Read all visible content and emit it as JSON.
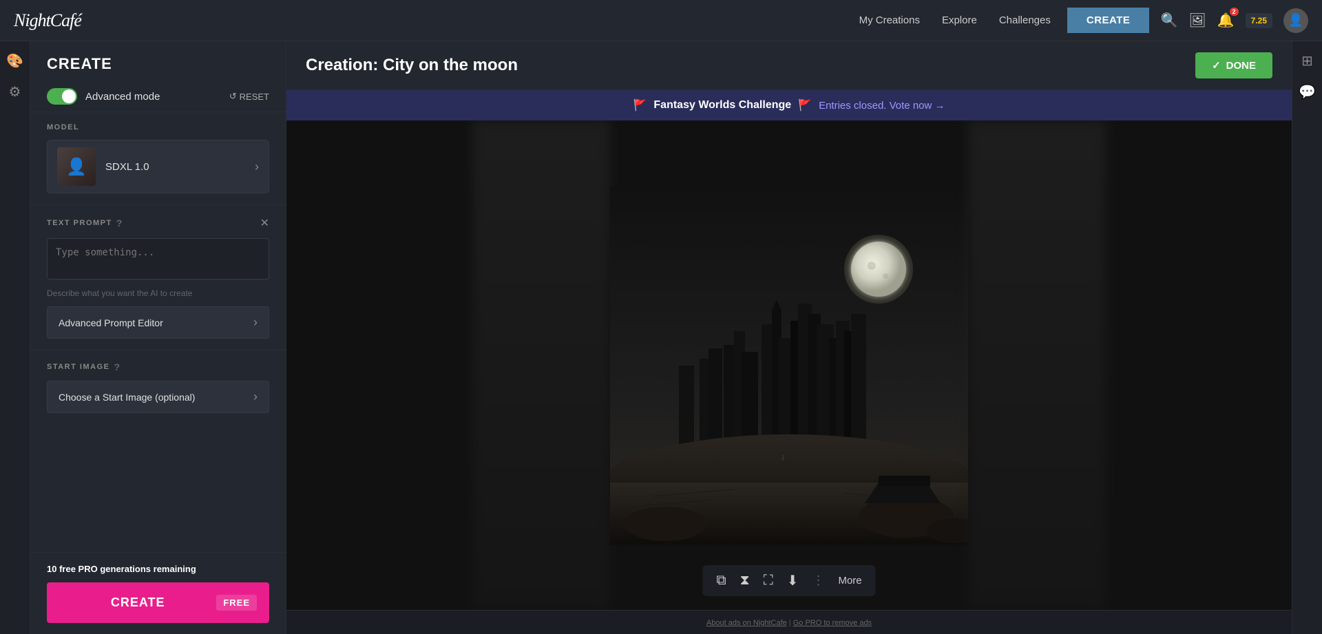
{
  "app": {
    "logo": "NightCafé"
  },
  "nav": {
    "links": [
      {
        "label": "My Creations",
        "key": "my-creations"
      },
      {
        "label": "Explore",
        "key": "explore"
      },
      {
        "label": "Challenges",
        "key": "challenges"
      }
    ],
    "create_label": "CREATE",
    "credits": "7.25",
    "notification_count": "2"
  },
  "sidebar": {
    "title": "CREATE",
    "advanced_mode": {
      "label": "Advanced mode",
      "enabled": true
    },
    "reset_label": "RESET",
    "model_section_label": "MODEL",
    "model": {
      "name": "SDXL 1.0"
    },
    "text_prompt": {
      "section_label": "TEXT PROMPT",
      "placeholder": "Type something...",
      "hint": "Describe what you want the AI to create",
      "advanced_editor_label": "Advanced Prompt Editor"
    },
    "start_image": {
      "section_label": "START IMAGE",
      "button_label": "Choose a Start Image (optional)"
    },
    "free_generations": {
      "count": "10",
      "text": "free PRO generations remaining"
    },
    "create_button": "CREATE",
    "free_tag": "FREE"
  },
  "creation": {
    "title": "Creation: City on the moon",
    "done_label": "DONE"
  },
  "challenge": {
    "emoji_left": "🚩",
    "name": "Fantasy Worlds Challenge",
    "emoji_right": "🚩",
    "link_text": "Entries closed. Vote now →"
  },
  "image_toolbar": {
    "copy_icon": "⧉",
    "hourglass_icon": "⧖",
    "expand_icon": "⛶",
    "download_icon": "⬇",
    "more_label": "More"
  },
  "footer": {
    "text1": "About ads on NightCafe",
    "separator": " | ",
    "text2": "Go PRO to remove ads"
  }
}
